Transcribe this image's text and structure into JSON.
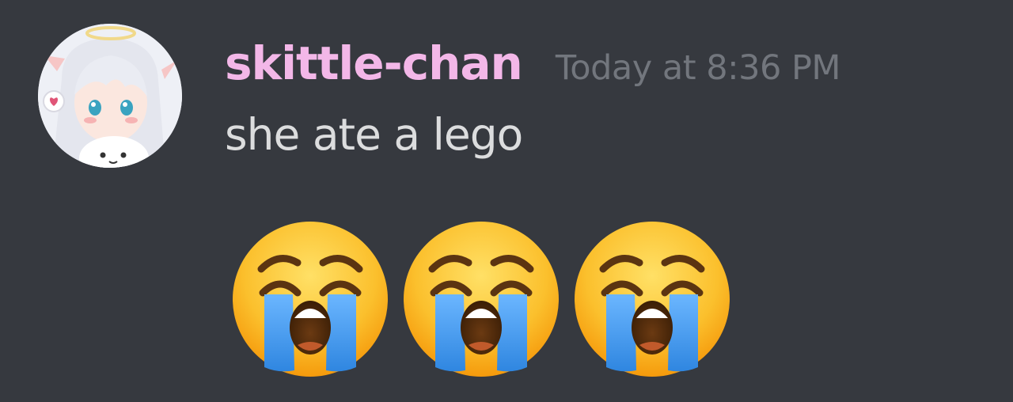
{
  "message": {
    "author": {
      "username": "skittle-chan",
      "name_color": "#f3b7e8",
      "avatar_icon": "anime-angel-girl-avatar"
    },
    "timestamp": "Today at 8:36 PM",
    "content": "she ate a lego",
    "emojis": [
      {
        "name": "loudly_crying_face",
        "icon": "loudly-crying-face-icon"
      },
      {
        "name": "loudly_crying_face",
        "icon": "loudly-crying-face-icon"
      },
      {
        "name": "loudly_crying_face",
        "icon": "loudly-crying-face-icon"
      }
    ]
  },
  "colors": {
    "background": "#36393f",
    "text": "#dcddde",
    "timestamp": "#72767d"
  }
}
